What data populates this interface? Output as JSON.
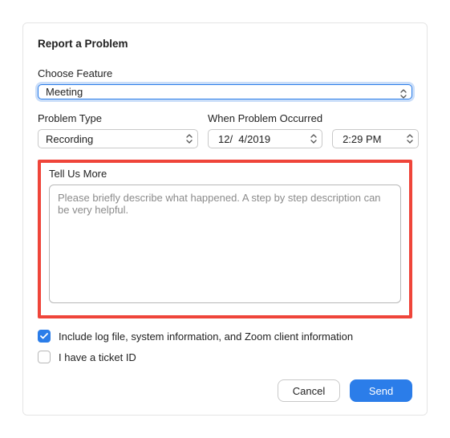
{
  "title": "Report a Problem",
  "feature": {
    "label": "Choose Feature",
    "value": "Meeting"
  },
  "problem_type": {
    "label": "Problem Type",
    "value": "Recording"
  },
  "when": {
    "label": "When Problem Occurred",
    "date": "12/  4/2019",
    "time": "2:29 PM"
  },
  "tell_us_more": {
    "label": "Tell Us More",
    "placeholder": "Please briefly describe what happened. A step by step description can be very helpful."
  },
  "include_log": {
    "label": "Include log file, system information, and Zoom client information",
    "checked": true
  },
  "ticket": {
    "label": "I have a ticket ID",
    "checked": false
  },
  "buttons": {
    "cancel": "Cancel",
    "send": "Send"
  }
}
